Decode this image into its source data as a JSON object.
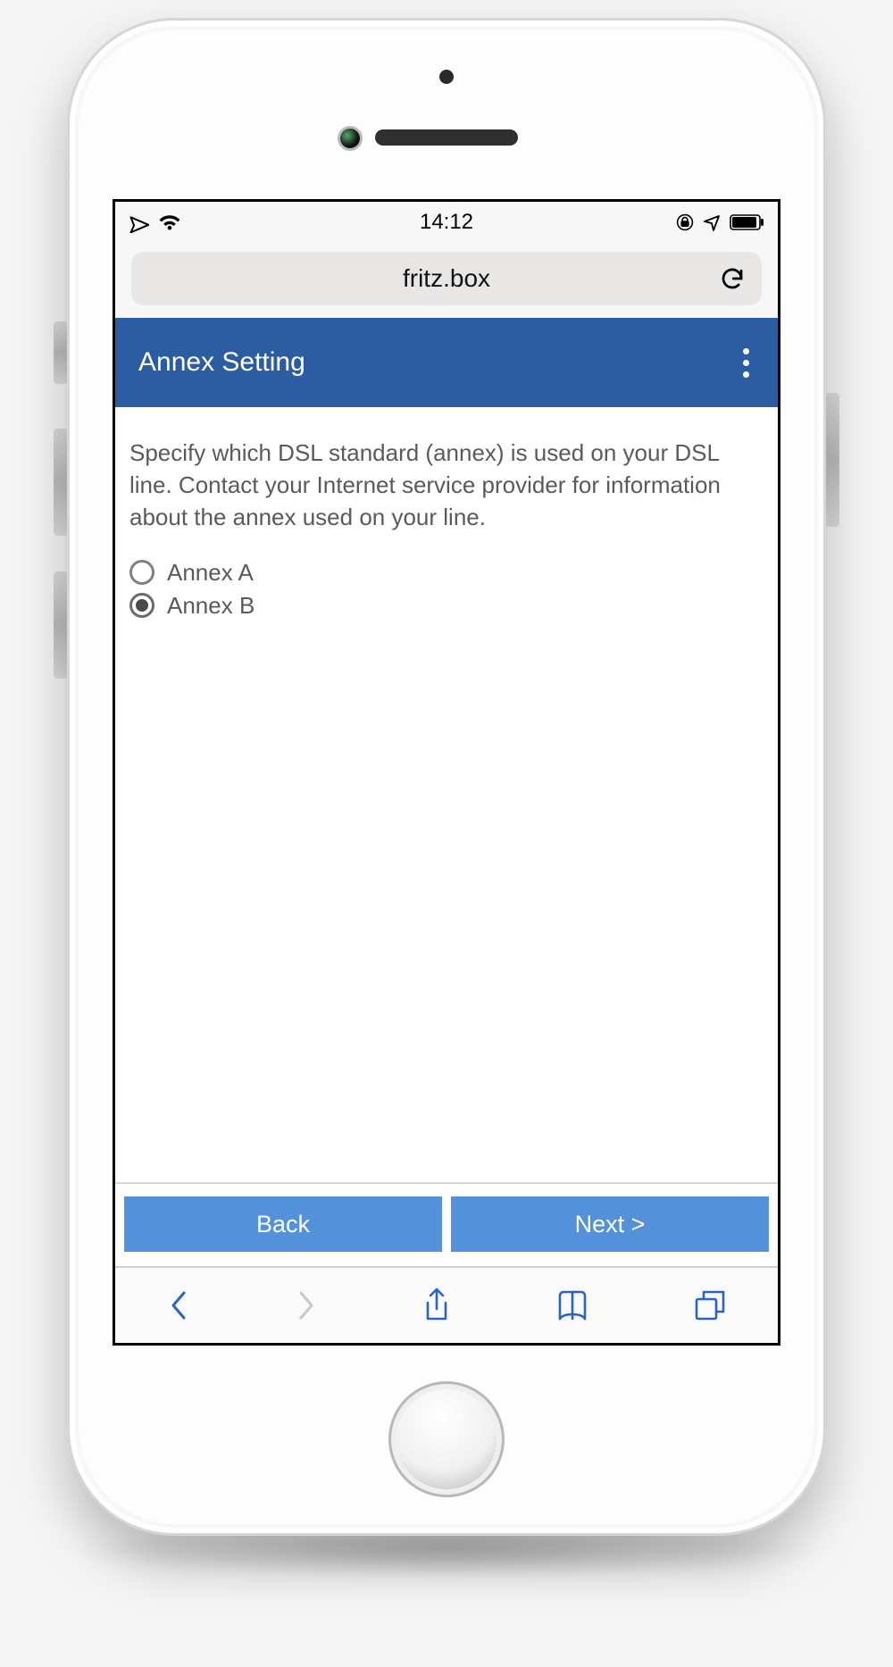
{
  "status_bar": {
    "time": "14:12"
  },
  "browser": {
    "url": "fritz.box"
  },
  "header": {
    "title": "Annex Setting"
  },
  "body": {
    "description": "Specify which DSL standard (annex) is used on your DSL line. Contact your Internet service provider for information about the annex used on your line.",
    "options": [
      {
        "label": "Annex A",
        "selected": false
      },
      {
        "label": "Annex B",
        "selected": true
      }
    ]
  },
  "footer": {
    "back": "Back",
    "next": "Next >"
  }
}
